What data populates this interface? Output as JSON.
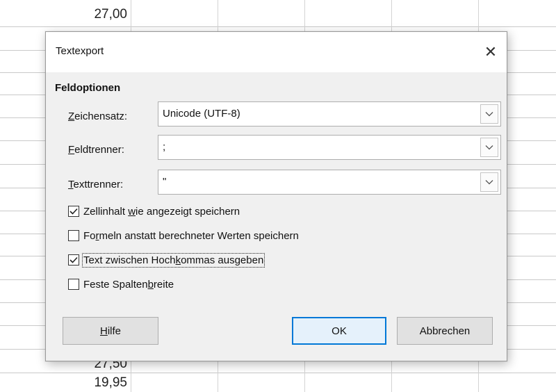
{
  "spreadsheet": {
    "cells": [
      {
        "id": "top",
        "value": "27,00"
      },
      {
        "id": "bottom1",
        "value": "27,50"
      },
      {
        "id": "bottom2",
        "value": "19,95"
      }
    ]
  },
  "dialog": {
    "title": "Textexport",
    "close_symbol": "✕",
    "section_title": "Feldoptionen",
    "fields": [
      {
        "label_pre": "",
        "label_key": "Z",
        "label_post": "eichensatz:",
        "value": "Unicode (UTF-8)"
      },
      {
        "label_pre": "",
        "label_key": "F",
        "label_post": "eldtrenner:",
        "value": ";"
      },
      {
        "label_pre": "",
        "label_key": "T",
        "label_post": "exttrenner:",
        "value": "\""
      }
    ],
    "options": [
      {
        "label_pre": "Zellinhalt ",
        "label_key": "w",
        "label_post": "ie angezeigt speichern",
        "checked": true
      },
      {
        "label_pre": "Fo",
        "label_key": "r",
        "label_post": "meln anstatt berechneter Werten speichern",
        "checked": false
      },
      {
        "label_pre": "Text zwischen Hoch",
        "label_key": "k",
        "label_post": "ommas ausgeben",
        "checked": true
      },
      {
        "label_pre": "Feste Spalten",
        "label_key": "b",
        "label_post": "reite",
        "checked": false
      }
    ],
    "buttons": {
      "help_key": "H",
      "help_post": "ilfe",
      "ok": "OK",
      "cancel": "Abbrechen"
    }
  },
  "colors": {
    "accent": "#0078d7",
    "dialog_bg": "#f0f0f0",
    "titlebar_bg": "#ffffff"
  },
  "icons": {
    "close": "close-icon",
    "dropdown": "chevron-down-icon",
    "check": "check-icon"
  }
}
